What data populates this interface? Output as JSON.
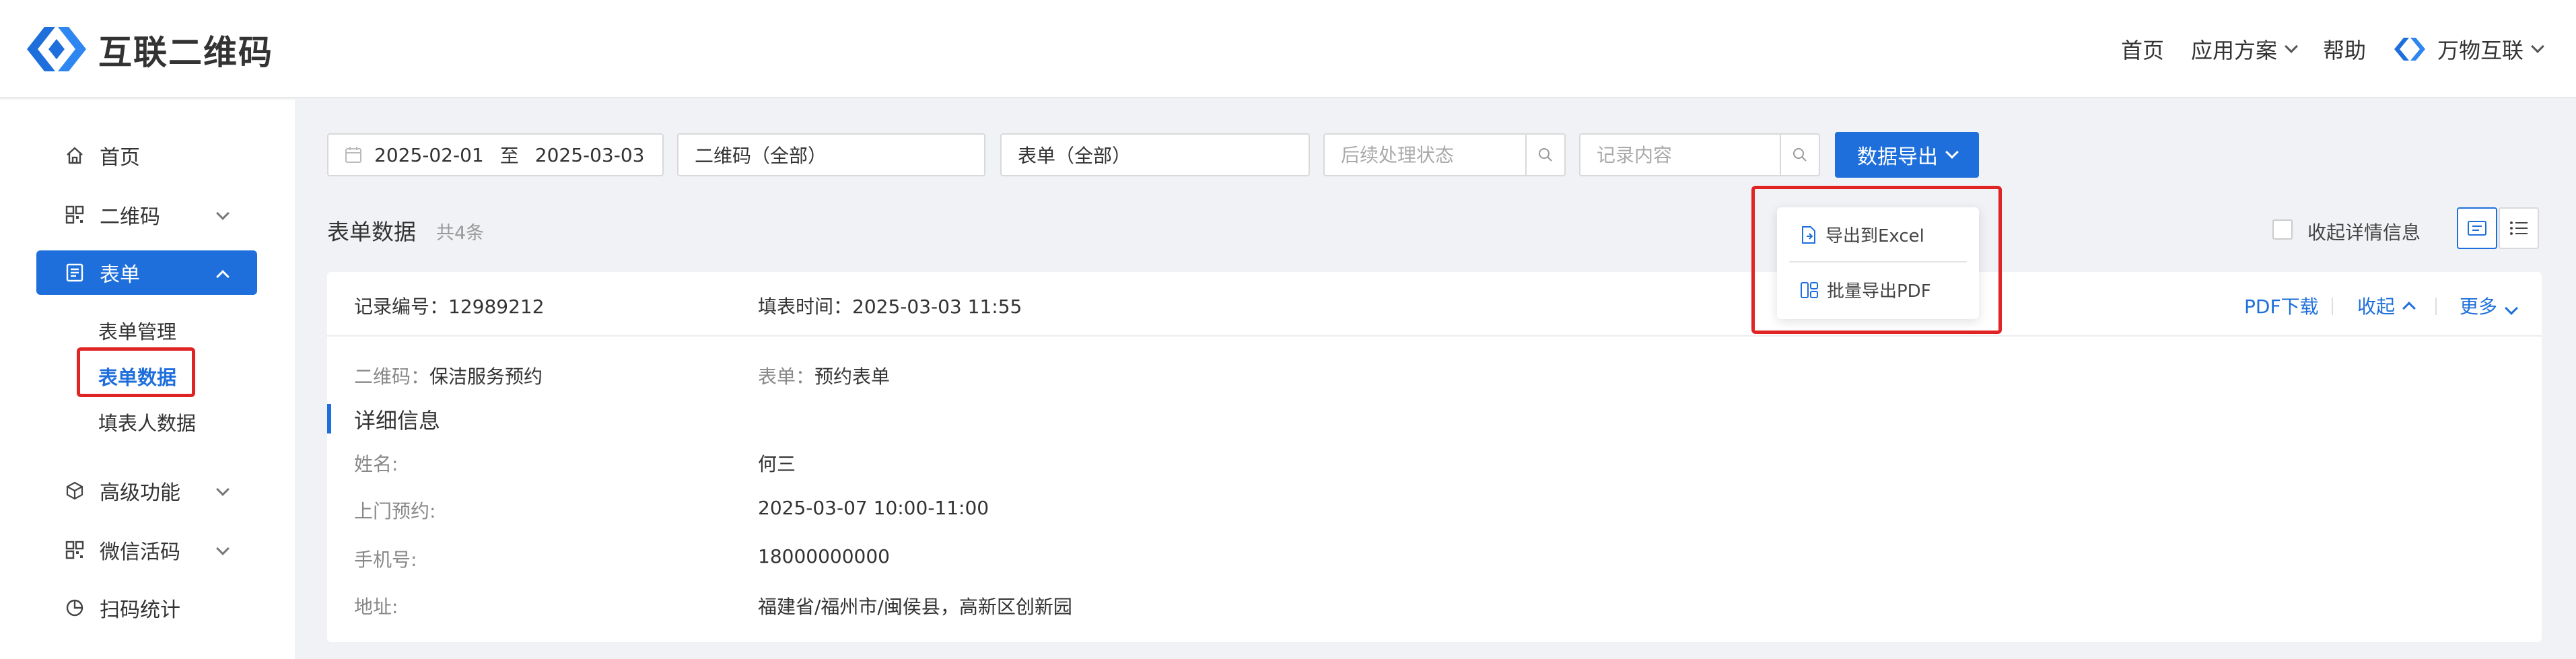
{
  "header": {
    "brand": "互联二维码",
    "nav": {
      "home": "首页",
      "solutions": "应用方案",
      "help": "帮助",
      "company": "万物互联"
    }
  },
  "sidebar": {
    "items": [
      {
        "label": "首页",
        "icon": "home-icon"
      },
      {
        "label": "二维码",
        "icon": "qrcode-icon"
      },
      {
        "label": "表单",
        "icon": "form-icon"
      },
      {
        "label": "高级功能",
        "icon": "cube-icon"
      },
      {
        "label": "微信活码",
        "icon": "qrcode-icon"
      },
      {
        "label": "扫码统计",
        "icon": "pie-chart-icon"
      }
    ],
    "form_sub": [
      "表单管理",
      "表单数据",
      "填表人数据"
    ]
  },
  "filters": {
    "date_start": "2025-02-01",
    "date_to": "至",
    "date_end": "2025-03-03",
    "qrcode_select": "二维码（全部）",
    "form_select": "表单（全部）",
    "status_placeholder": "后续处理状态",
    "content_placeholder": "记录内容",
    "export_label": "数据导出"
  },
  "export_menu": {
    "excel": "导出到Excel",
    "pdf": "批量导出PDF"
  },
  "section": {
    "title": "表单数据",
    "count": "共4条",
    "collapse_label": "收起详情信息"
  },
  "record": {
    "id_label": "记录编号：",
    "id": "12989212",
    "time_label": "填表时间：",
    "time": "2025-03-03 11:55",
    "pdf_download": "PDF下载",
    "collapse": "收起",
    "more": "更多",
    "qrcode_label": "二维码：",
    "qrcode": "保洁服务预约",
    "form_label": "表单：",
    "form": "预约表单",
    "detail_title": "详细信息",
    "fields": [
      {
        "label": "姓名:",
        "value": "何三"
      },
      {
        "label": "上门预约:",
        "value": "2025-03-07 10:00-11:00"
      },
      {
        "label": "手机号:",
        "value": "18000000000"
      },
      {
        "label": "地址:",
        "value": "福建省/福州市/闽侯县，高新区创新园"
      }
    ]
  },
  "colors": {
    "accent": "#1e6fdb",
    "highlight": "#e02424"
  }
}
